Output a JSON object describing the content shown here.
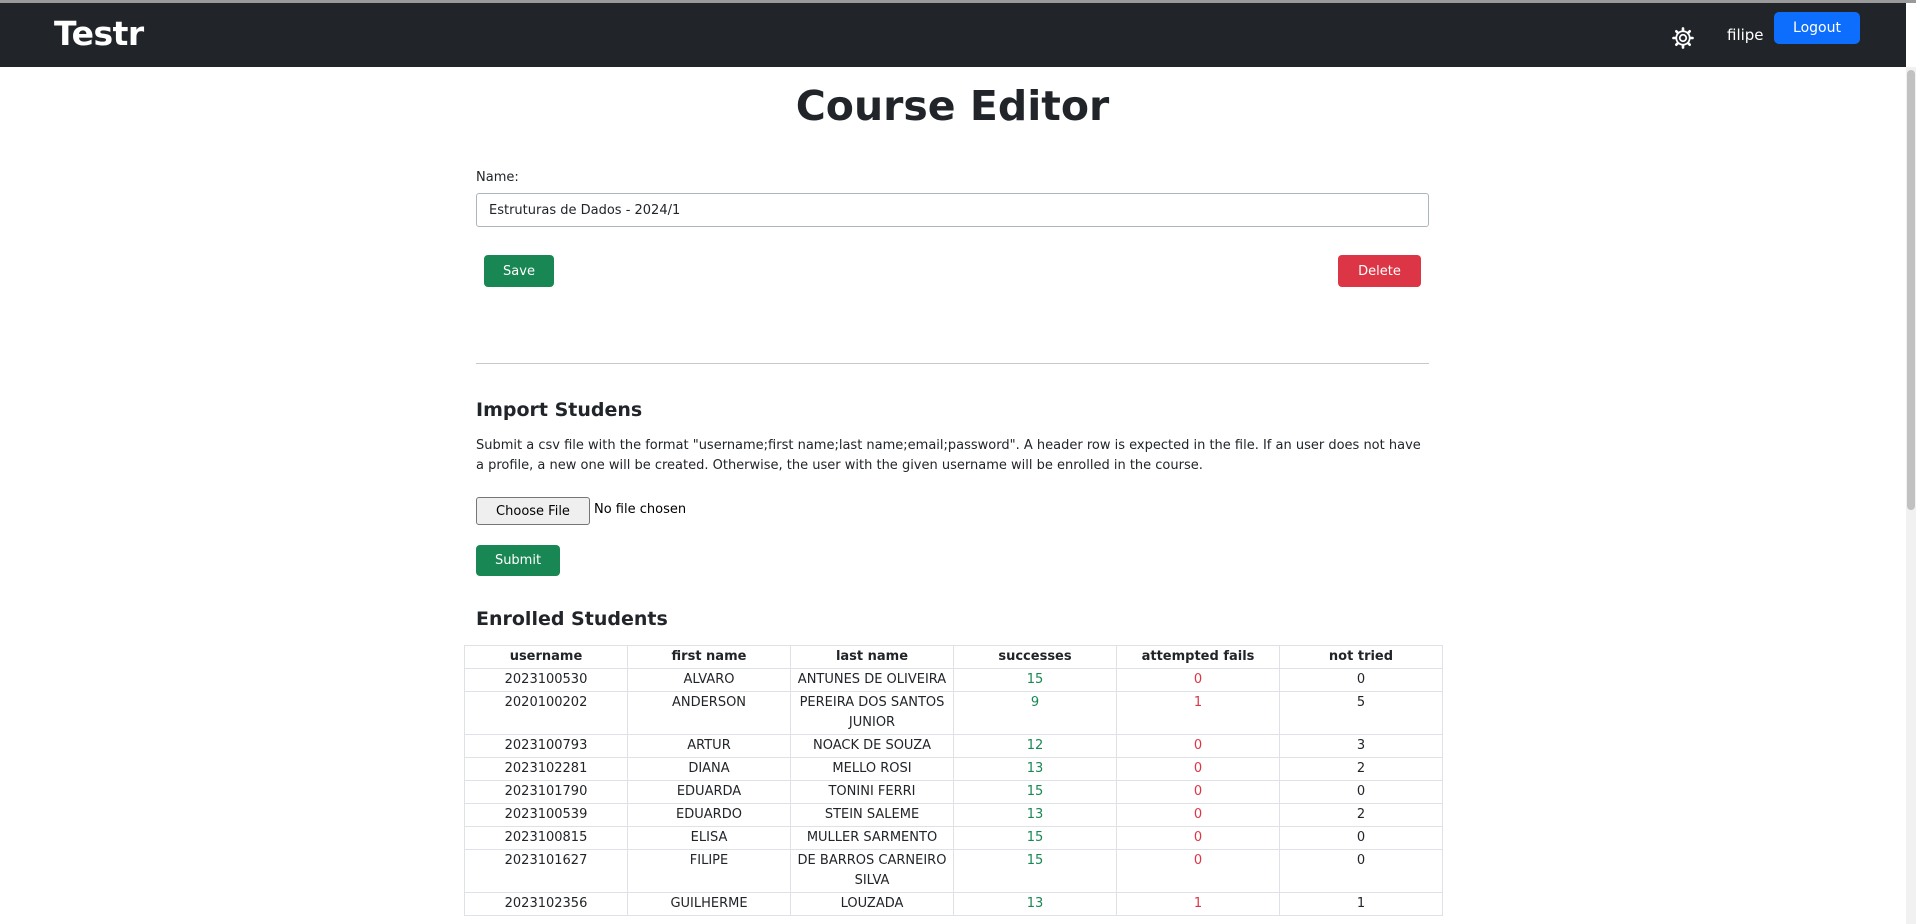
{
  "navbar": {
    "brand": "Testr",
    "settings_icon": "gear-icon",
    "username": "filipe",
    "logout_label": "Logout"
  },
  "editor": {
    "title": "Course Editor",
    "name_label": "Name:",
    "name_value": "Estruturas de Dados - 2024/1",
    "save_label": "Save",
    "delete_label": "Delete"
  },
  "import": {
    "heading": "Import Studens",
    "description": "Submit a csv file with the format \"username;first name;last name;email;password\". A header row is expected in the file. If an user does not have a profile, a new one will be created. Otherwise, the user with the given username will be enrolled in the course.",
    "choose_file_label": "Choose File",
    "file_status": "No file chosen",
    "submit_label": "Submit"
  },
  "enrolled": {
    "heading": "Enrolled Students",
    "columns": [
      "username",
      "first name",
      "last name",
      "successes",
      "attempted fails",
      "not tried"
    ],
    "rows": [
      [
        "2023100530",
        "ALVARO",
        "ANTUNES DE OLIVEIRA",
        "15",
        "0",
        "0"
      ],
      [
        "2020100202",
        "ANDERSON",
        "PEREIRA DOS SANTOS JUNIOR",
        "9",
        "1",
        "5"
      ],
      [
        "2023100793",
        "ARTUR",
        "NOACK DE SOUZA",
        "12",
        "0",
        "3"
      ],
      [
        "2023102281",
        "DIANA",
        "MELLO ROSI",
        "13",
        "0",
        "2"
      ],
      [
        "2023101790",
        "EDUARDA",
        "TONINI FERRI",
        "15",
        "0",
        "0"
      ],
      [
        "2023100539",
        "EDUARDO",
        "STEIN SALEME",
        "13",
        "0",
        "2"
      ],
      [
        "2023100815",
        "ELISA",
        "MULLER SARMENTO",
        "15",
        "0",
        "0"
      ],
      [
        "2023101627",
        "FILIPE",
        "DE BARROS CARNEIRO SILVA",
        "15",
        "0",
        "0"
      ],
      [
        "2023102356",
        "GUILHERME",
        "LOUZADA",
        "13",
        "1",
        "1"
      ]
    ]
  },
  "colors": {
    "navbar_bg": "#212529",
    "primary": "#0d6efd",
    "success": "#198754",
    "danger": "#dc3545"
  }
}
